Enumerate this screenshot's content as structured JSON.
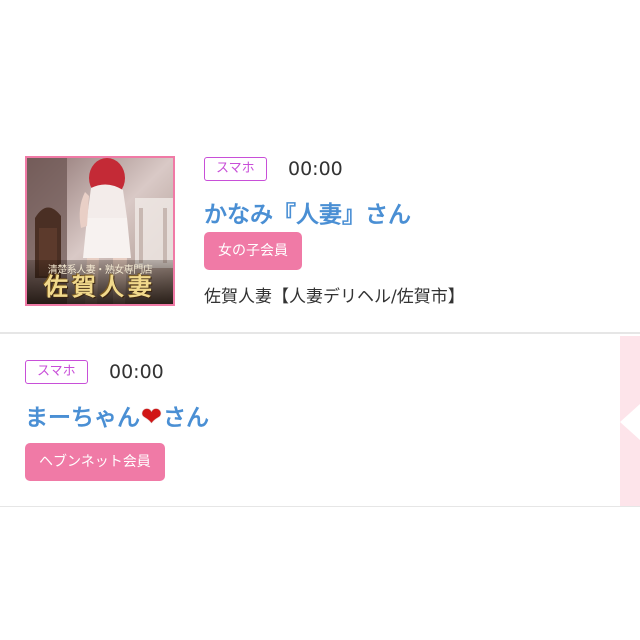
{
  "entries": [
    {
      "device_badge": "スマホ",
      "time": "00:00",
      "name": "かなみ『人妻』さん",
      "member_type": "女の子会員",
      "shop": "佐賀人妻【人妻デリヘル/佐賀市】",
      "thumbnail": {
        "tagline": "清楚系人妻・熟女専門店",
        "shop_logo": "佐賀人妻"
      }
    },
    {
      "device_badge": "スマホ",
      "time": "00:00",
      "name_prefix": "まーちゃん",
      "name_icon": "heart-icon",
      "heart_glyph": "❤",
      "name_suffix": "さん",
      "member_type": "ヘブンネット会員"
    }
  ],
  "colors": {
    "accent_pink": "#f07aa6",
    "badge_purple": "#c84fd8",
    "name_blue": "#4a8fd4",
    "heart_red": "#d11616"
  }
}
